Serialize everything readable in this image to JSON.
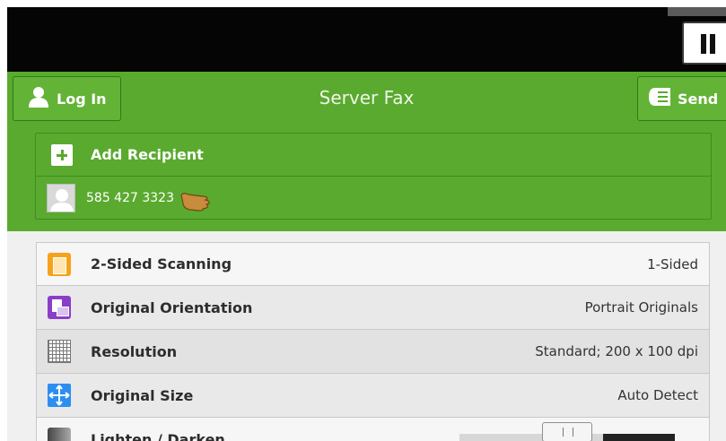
{
  "header": {
    "title": "Server Fax",
    "login_label": "Log In",
    "send_label": "Send"
  },
  "recipients": {
    "add_label": "Add Recipient",
    "entries": [
      {
        "number": "585 427 3323"
      }
    ]
  },
  "settings": [
    {
      "name": "2-Sided Scanning",
      "value": "1-Sided",
      "icon": "two-sided-scan-icon"
    },
    {
      "name": "Original Orientation",
      "value": "Portrait Originals",
      "icon": "orientation-icon"
    },
    {
      "name": "Resolution",
      "value": "Standard; 200 x 100 dpi",
      "icon": "resolution-grid-icon"
    },
    {
      "name": "Original Size",
      "value": "Auto Detect",
      "icon": "original-size-icon"
    },
    {
      "name": "Lighten / Darken",
      "value": "",
      "icon": "lighten-darken-icon"
    }
  ],
  "colors": {
    "header_green": "#5aaa2f",
    "top_bar": "#050505"
  }
}
